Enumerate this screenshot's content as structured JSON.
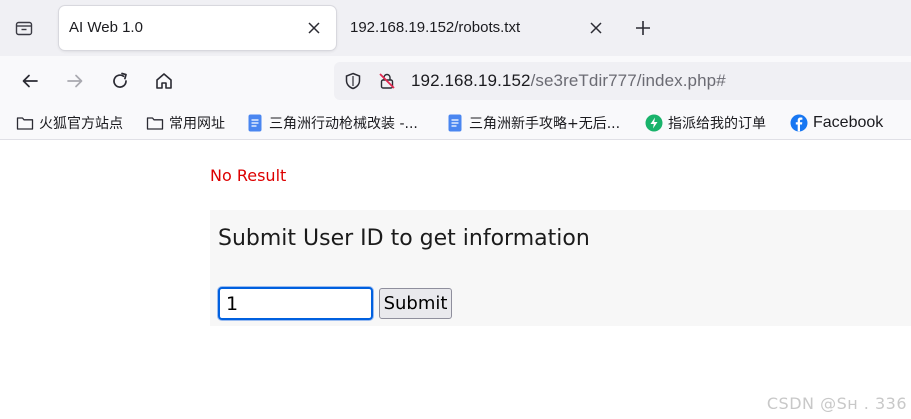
{
  "tabs": {
    "active": {
      "title": "AI Web 1.0"
    },
    "inactive": {
      "title": "192.168.19.152/robots.txt"
    }
  },
  "url": {
    "host": "192.168.19.152",
    "path": "/se3reTdir777/index.php#"
  },
  "bookmarks": [
    {
      "label": "火狐官方站点",
      "icon": "folder-icon"
    },
    {
      "label": "常用网址",
      "icon": "folder-icon"
    },
    {
      "label": "三角洲行动枪械改装 -...",
      "icon": "doc-icon"
    },
    {
      "label": "三角洲新手攻略+无后...",
      "icon": "doc-icon"
    },
    {
      "label": "指派给我的订单",
      "icon": "bolt-icon"
    },
    {
      "label": "Facebook",
      "icon": "facebook-icon"
    }
  ],
  "page": {
    "status": "No Result",
    "form_title": "Submit User ID to get information",
    "input_value": "1",
    "submit_label": "Submit"
  },
  "watermark": "CSDN @Sн    . 336",
  "colors": {
    "status_red": "#dd0000",
    "focus_blue": "#0060df",
    "doc_icon_blue": "#4a86f0",
    "bolt_icon_green": "#19b36b",
    "facebook_blue": "#1877f2"
  }
}
